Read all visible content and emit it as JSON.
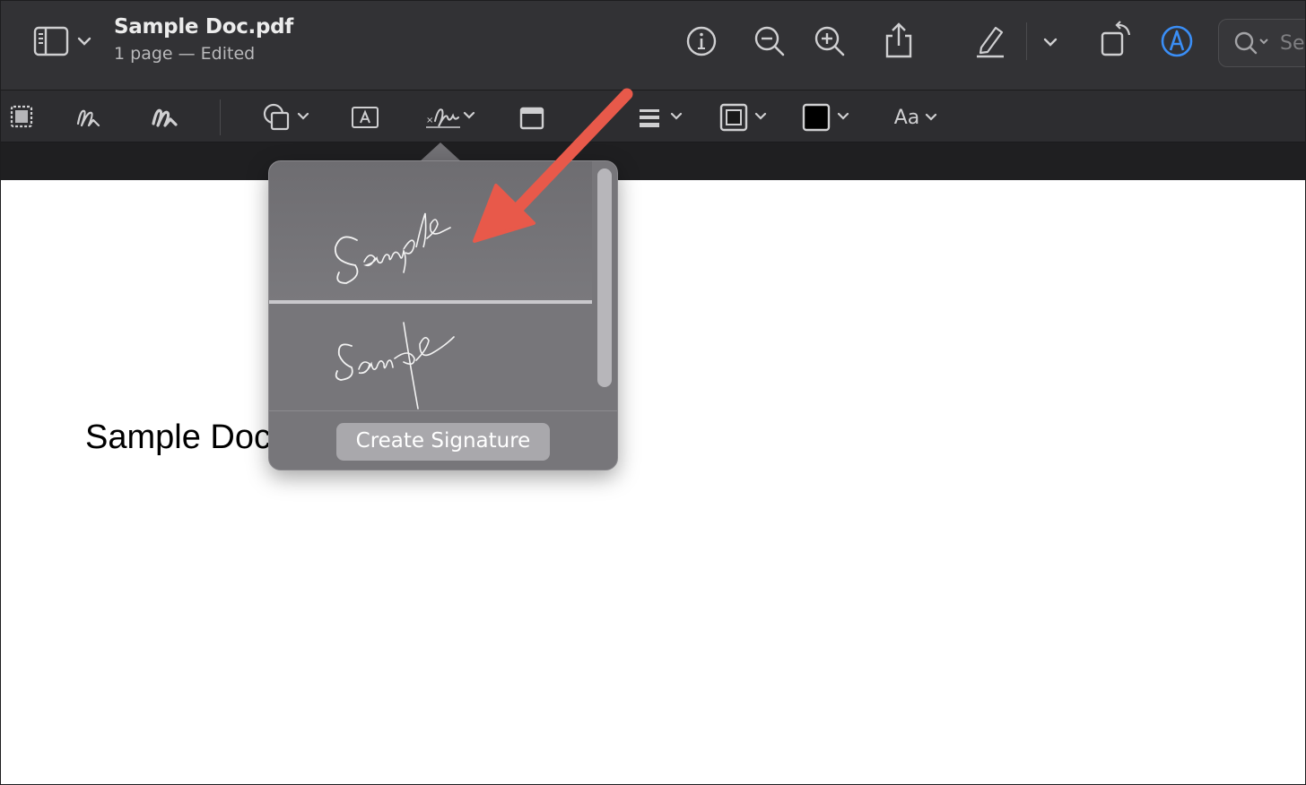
{
  "titlebar": {
    "doc_title": "Sample Doc.pdf",
    "doc_subtitle": "1 page — Edited",
    "search_placeholder": "Se"
  },
  "markup": {
    "text_style_label": "Aa"
  },
  "document": {
    "visible_text": "Sample Doc"
  },
  "signature_popover": {
    "signatures": [
      "signature-1",
      "signature-2"
    ],
    "create_label": "Create Signature"
  },
  "colors": {
    "titlebar_bg": "#323235",
    "toolbar_bg": "#2d2d30",
    "popover_bg": "#77767a",
    "annotation_arrow": "#e8594a",
    "markup_accent": "#3a8ef6"
  },
  "icons": [
    "sidebar-icon",
    "info-icon",
    "zoom-out-icon",
    "zoom-in-icon",
    "share-icon",
    "highlight-pen-icon",
    "rotate-icon",
    "markup-icon",
    "search-icon",
    "selection-icon",
    "sketch-icon",
    "draw-icon",
    "shapes-icon",
    "text-box-icon",
    "signature-icon",
    "note-icon",
    "line-style-icon",
    "border-color-icon",
    "fill-color-icon"
  ]
}
